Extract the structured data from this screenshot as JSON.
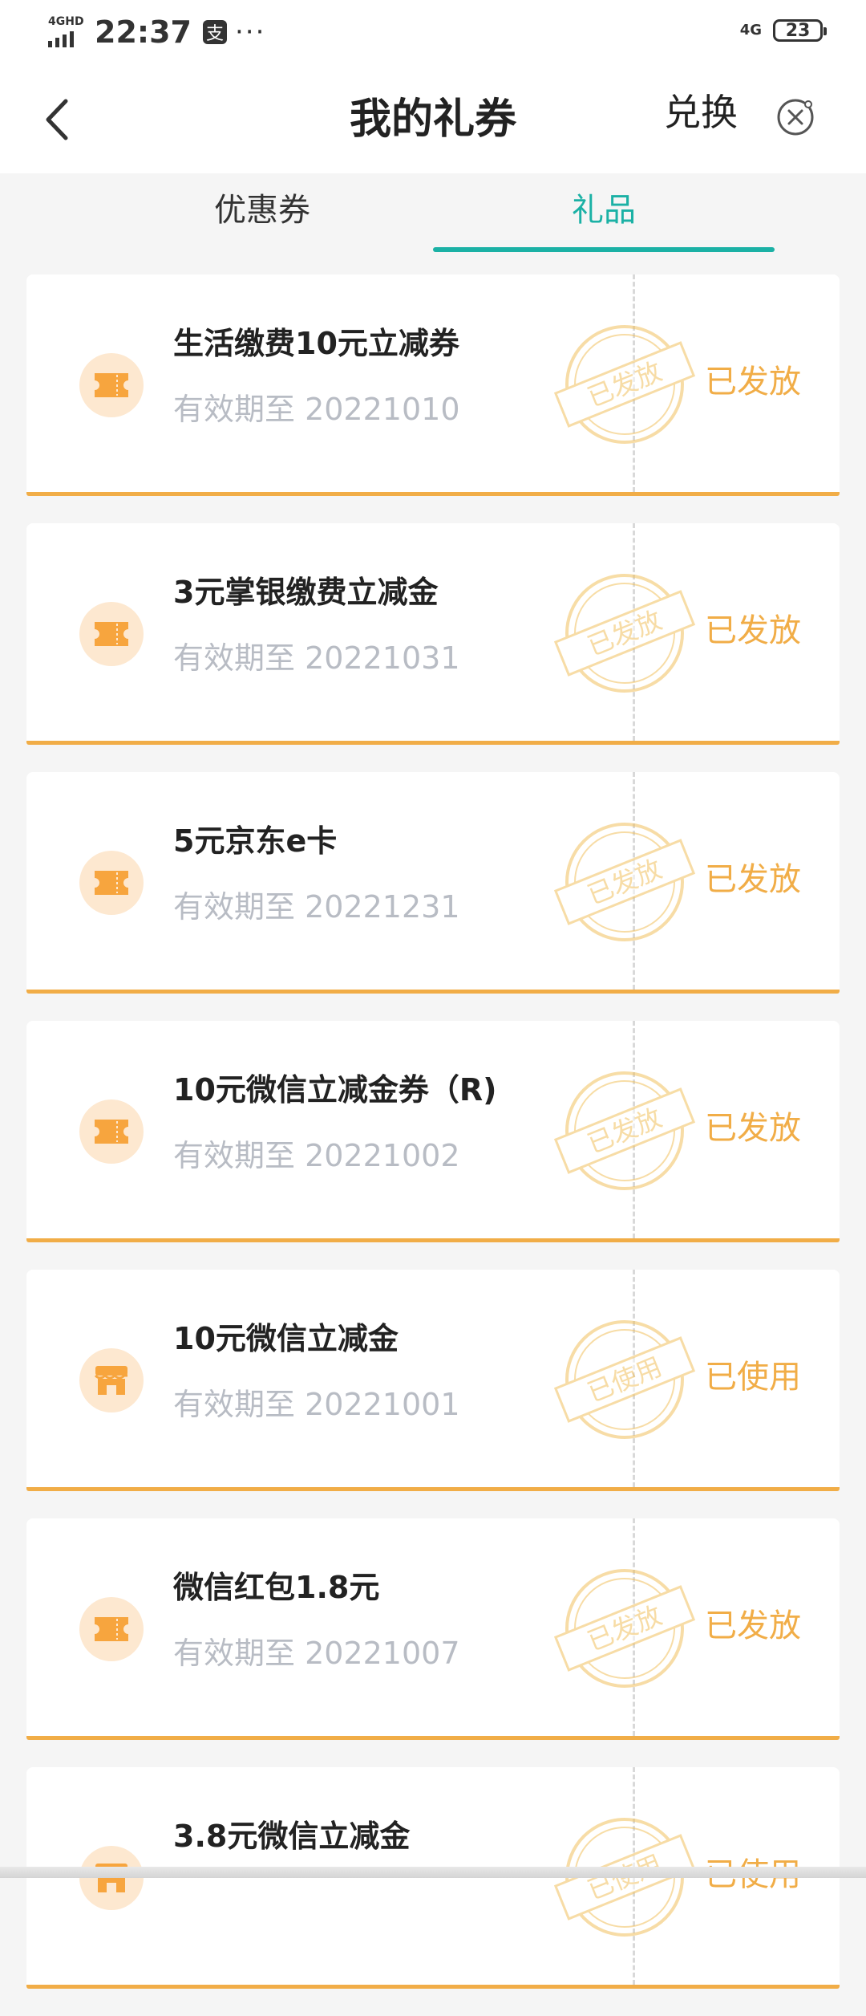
{
  "status_bar": {
    "network": "4GHD",
    "time": "22:37",
    "app_badge": "支",
    "more": "···",
    "signal_right": "4G",
    "battery": "23"
  },
  "nav": {
    "title": "我的礼券",
    "exchange": "兑换"
  },
  "tabs": [
    {
      "label": "优惠券",
      "active": false
    },
    {
      "label": "礼品",
      "active": true
    }
  ],
  "gifts": [
    {
      "title": "生活缴费10元立减券",
      "date": "有效期至 20221010",
      "status": "已发放",
      "stamp": "已发放",
      "icon": "ticket-icon"
    },
    {
      "title": "3元掌银缴费立减金",
      "date": "有效期至 20221031",
      "status": "已发放",
      "stamp": "已发放",
      "icon": "ticket-icon"
    },
    {
      "title": "5元京东e卡",
      "date": "有效期至 20221231",
      "status": "已发放",
      "stamp": "已发放",
      "icon": "ticket-icon"
    },
    {
      "title": "10元微信立减金券（R)",
      "date": "有效期至 20221002",
      "status": "已发放",
      "stamp": "已发放",
      "icon": "ticket-icon"
    },
    {
      "title": "10元微信立减金",
      "date": "有效期至 20221001",
      "status": "已使用",
      "stamp": "已使用",
      "icon": "store-icon"
    },
    {
      "title": "微信红包1.8元",
      "date": "有效期至 20221007",
      "status": "已发放",
      "stamp": "已发放",
      "icon": "ticket-icon"
    },
    {
      "title": "3.8元微信立减金",
      "date": "",
      "status": "已使用",
      "stamp": "已使用",
      "icon": "store-icon"
    }
  ],
  "colors": {
    "accent_teal": "#1bb1a5",
    "status_orange": "#f1ad47",
    "icon_bg": "#fde8d0",
    "icon_fg": "#f7a53e"
  }
}
